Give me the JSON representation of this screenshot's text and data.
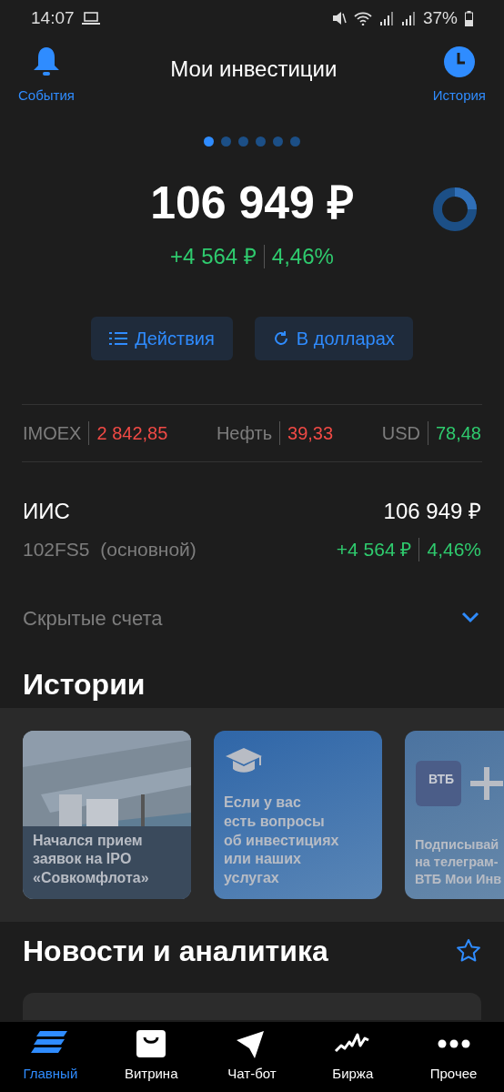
{
  "status_bar": {
    "time": "14:07",
    "battery": "37%"
  },
  "header": {
    "title": "Мои инвестиции",
    "left_action": "События",
    "right_action": "История"
  },
  "pager": [
    {
      "selected": true
    },
    {
      "selected": false
    },
    {
      "selected": false
    },
    {
      "selected": false
    },
    {
      "selected": false
    },
    {
      "selected": false
    }
  ],
  "portfolio": {
    "total": "106 949 ₽",
    "change": "+4 564 ₽",
    "change_percent": "4,46%"
  },
  "actions": [
    {
      "kind": "list",
      "label": "Действия"
    },
    {
      "kind": "refresh",
      "label": "В долларах"
    }
  ],
  "tickers": [
    {
      "name": "IMOEX",
      "value": "2 842,85",
      "color": "#f04a45"
    },
    {
      "name": "Нефть",
      "value": "39,33",
      "color": "#f04a45"
    },
    {
      "name": "USD",
      "value": "78,48",
      "color": "#2fcb6e"
    }
  ],
  "account": {
    "name": "ИИС",
    "number": "102FS5  (основной)",
    "total": "106 949 ₽",
    "change": "+4 564 ₽",
    "change_percent": "4,46%"
  },
  "hidden_accounts": {
    "label": "Скрытые счета",
    "expanded": false
  },
  "stories": {
    "title": "Истории",
    "items": [
      {
        "lines": [
          "Начался прием",
          "заявок на IPO",
          "«Совкомфлота»"
        ]
      },
      {
        "kind": "education",
        "lines": [
          "Если у вас",
          "есть вопросы",
          "об инвестициях",
          "или наших",
          "услугах"
        ]
      },
      {
        "kind": "telegram",
        "logo": "ВТБ",
        "lines": [
          "Подписывай",
          "на телеграм-",
          "ВТБ Мои Инв"
        ]
      }
    ]
  },
  "news": {
    "title": "Новости и аналитика"
  },
  "tab_bar": [
    {
      "kind": "home",
      "label": "Главный",
      "selected": true
    },
    {
      "kind": "shop",
      "label": "Витрина",
      "selected": false
    },
    {
      "kind": "chat",
      "label": "Чат-бот",
      "selected": false
    },
    {
      "kind": "market",
      "label": "Биржа",
      "selected": false
    },
    {
      "kind": "more",
      "label": "Прочее",
      "selected": false
    }
  ]
}
